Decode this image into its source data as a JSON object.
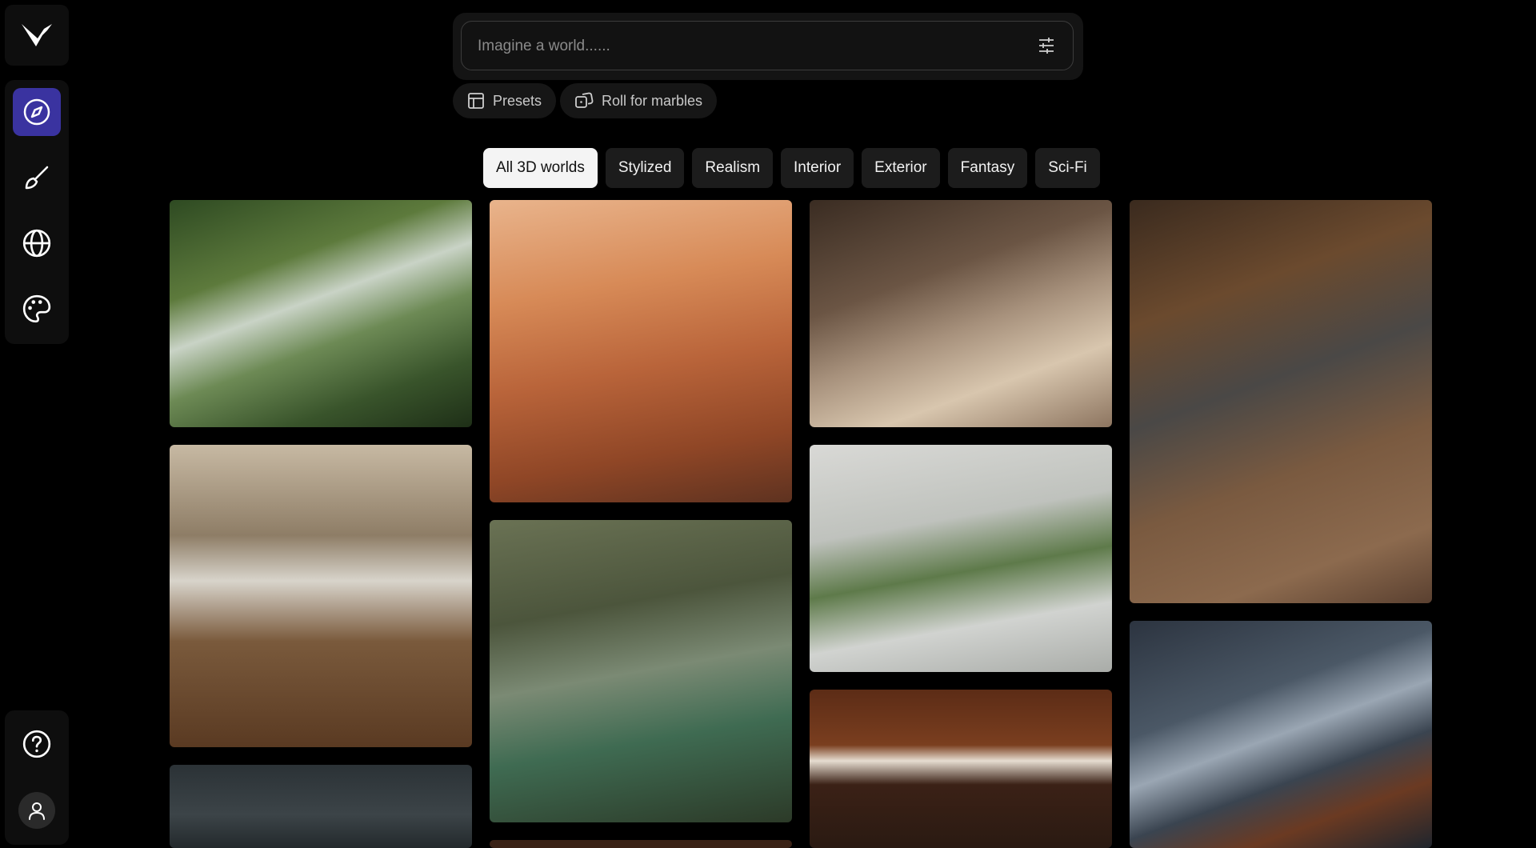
{
  "sidebar": {
    "logo": "logo-icon",
    "nav": [
      {
        "name": "explore",
        "icon": "compass-icon",
        "active": true
      },
      {
        "name": "create",
        "icon": "brush-icon",
        "active": false
      },
      {
        "name": "worlds",
        "icon": "globe-icon",
        "active": false
      },
      {
        "name": "styles",
        "icon": "palette-icon",
        "active": false
      }
    ],
    "bottom": [
      {
        "name": "help",
        "icon": "help-icon"
      },
      {
        "name": "account",
        "icon": "user-icon"
      }
    ]
  },
  "prompt": {
    "placeholder": "Imagine a world......",
    "value": ""
  },
  "actions": {
    "presets_label": "Presets",
    "roll_label": "Roll for marbles"
  },
  "filters": [
    {
      "label": "All 3D worlds",
      "active": true
    },
    {
      "label": "Stylized",
      "active": false
    },
    {
      "label": "Realism",
      "active": false
    },
    {
      "label": "Interior",
      "active": false
    },
    {
      "label": "Exterior",
      "active": false
    },
    {
      "label": "Fantasy",
      "active": false
    },
    {
      "label": "Sci-Fi",
      "active": false
    }
  ],
  "colors": {
    "background": "#000000",
    "accent": "#3a33a0",
    "active_tab": "#f4f4f4",
    "tab": "#1c1c1c"
  }
}
